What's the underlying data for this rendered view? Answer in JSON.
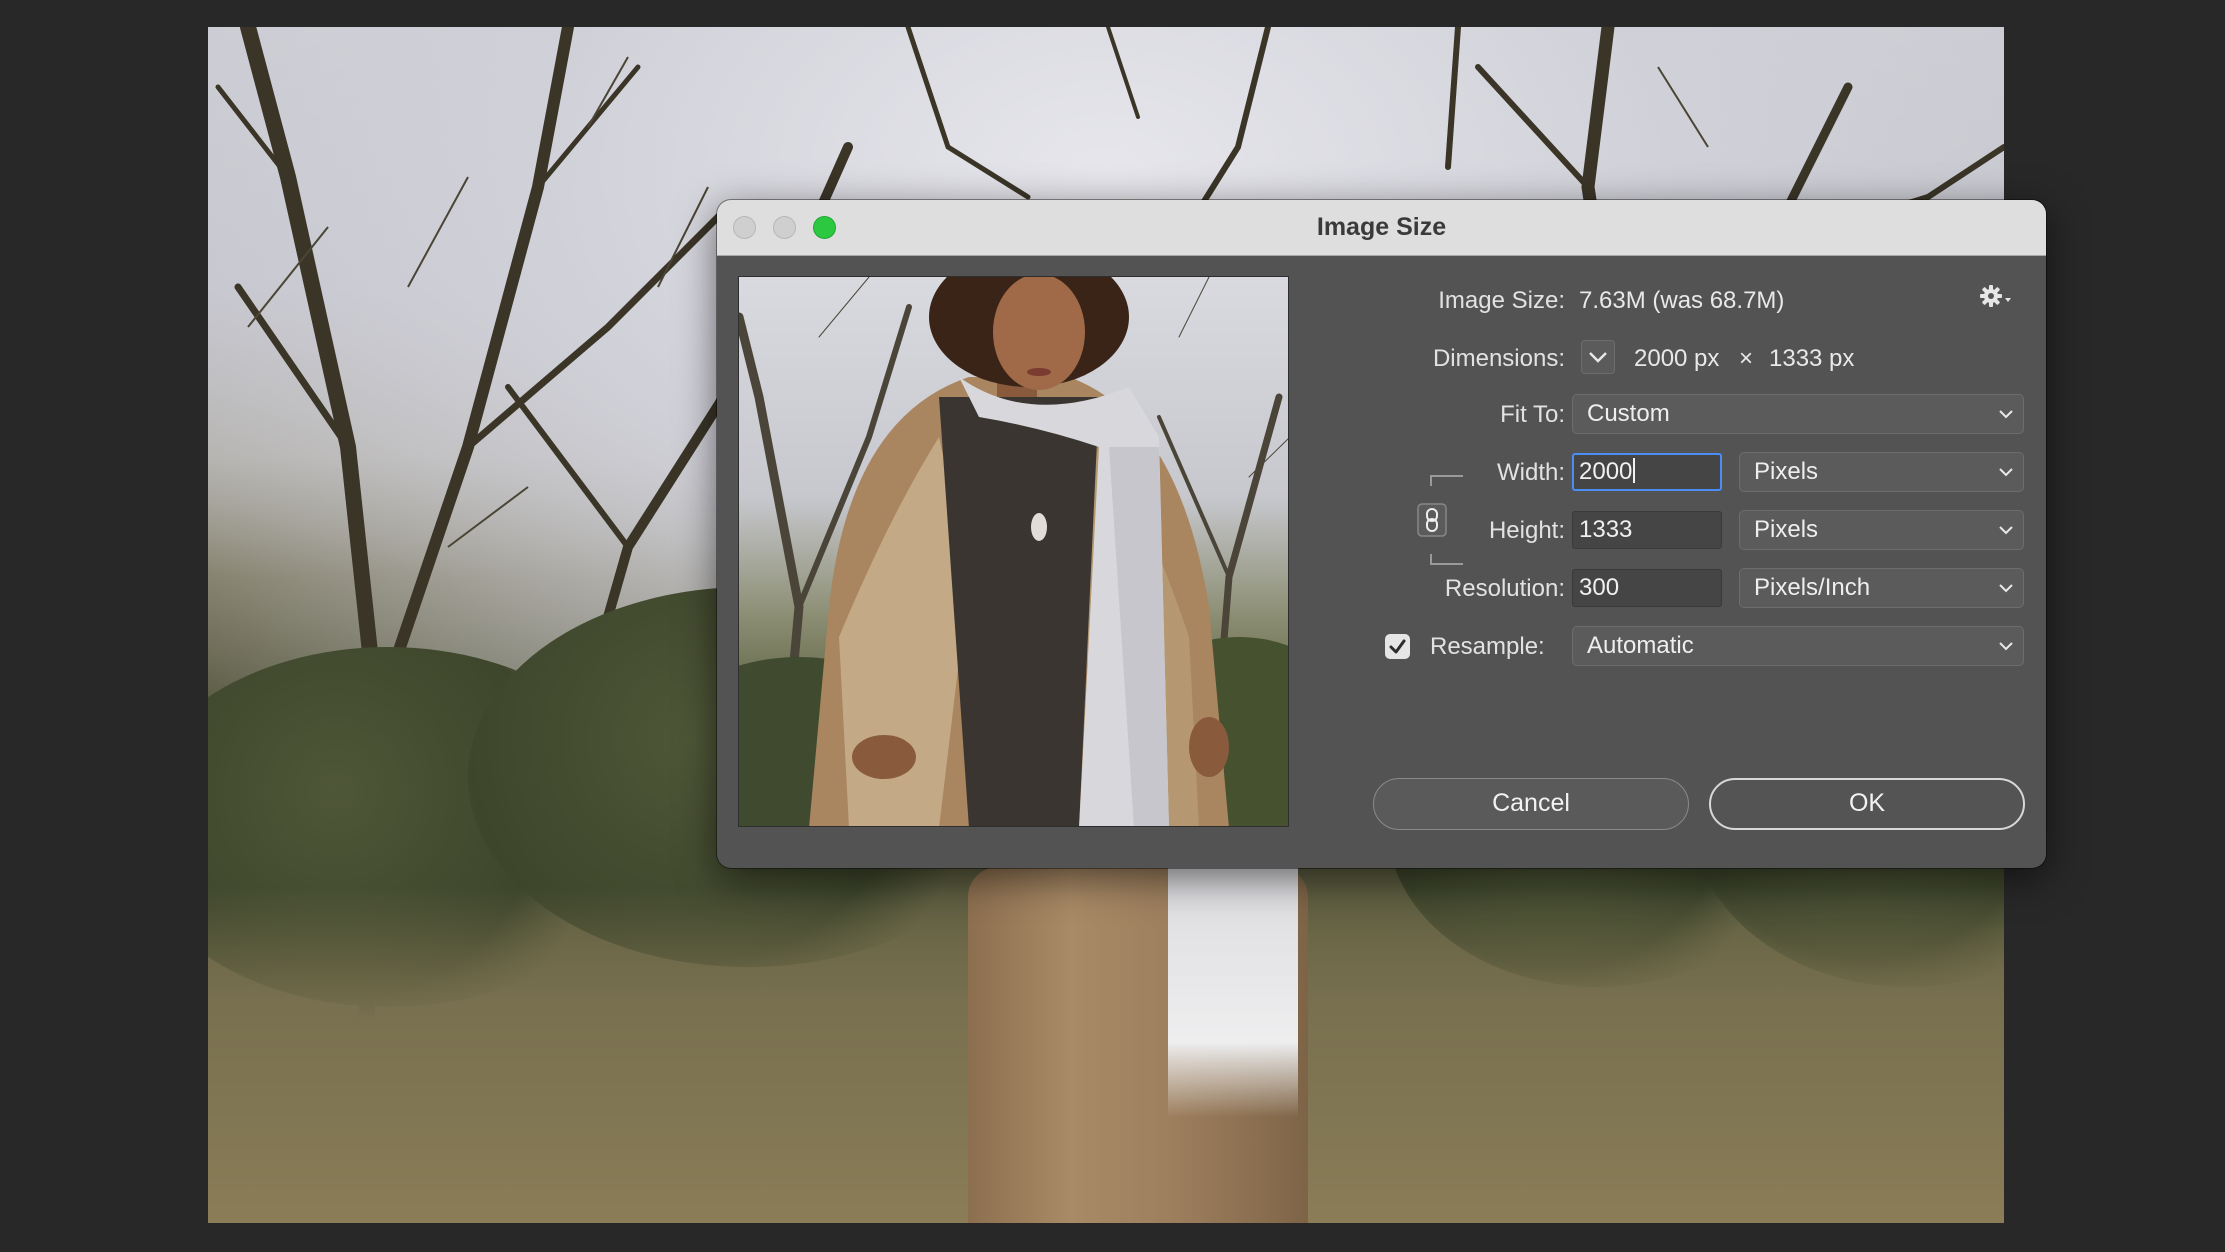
{
  "window": {
    "title": "Image Size"
  },
  "image_size": {
    "label": "Image Size:",
    "value": "7.63M (was 68.7M)"
  },
  "dimensions": {
    "label": "Dimensions:",
    "width": "2000 px",
    "separator": "×",
    "height": "1333 px"
  },
  "fit_to": {
    "label": "Fit To:",
    "selected": "Custom"
  },
  "width": {
    "label": "Width:",
    "value": "2000",
    "unit": "Pixels"
  },
  "height": {
    "label": "Height:",
    "value": "1333",
    "unit": "Pixels"
  },
  "resolution": {
    "label": "Resolution:",
    "value": "300",
    "unit": "Pixels/Inch"
  },
  "resample": {
    "label": "Resample:",
    "checked": true,
    "selected": "Automatic"
  },
  "buttons": {
    "cancel": "Cancel",
    "ok": "OK"
  },
  "icons": {
    "close": "close-window-icon",
    "minimize": "minimize-window-icon",
    "zoom": "zoom-window-icon",
    "settings": "gear-icon",
    "constrain": "link-chain-icon",
    "dimensions_toggle": "chevron-down-icon"
  },
  "colors": {
    "dialog_bg": "#535353",
    "titlebar_bg": "#dedede",
    "focus": "#4a8ef5",
    "zoom_button": "#2bc840"
  }
}
